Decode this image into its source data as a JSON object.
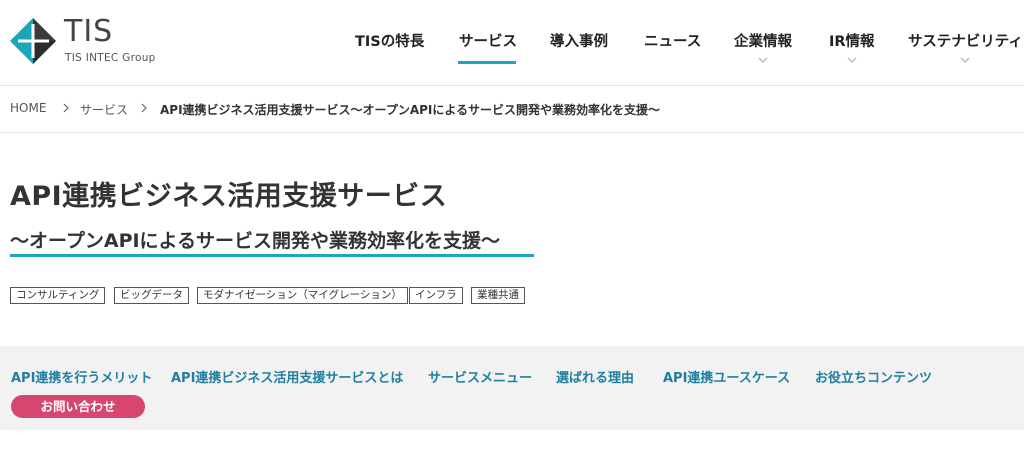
{
  "brand": {
    "name": "TIS",
    "tagline": "TIS INTEC Group",
    "colors": {
      "teal": "#1ba6b9",
      "dark": "#3a3a3a",
      "accent_pink": "#d6466e",
      "link_blue": "#1e7fa0"
    }
  },
  "global_nav": {
    "items": [
      {
        "label": "TISの特長",
        "has_dropdown": false,
        "active": false
      },
      {
        "label": "サービス",
        "has_dropdown": false,
        "active": true
      },
      {
        "label": "導入事例",
        "has_dropdown": false,
        "active": false
      },
      {
        "label": "ニュース",
        "has_dropdown": false,
        "active": false
      },
      {
        "label": "企業情報",
        "has_dropdown": true,
        "active": false
      },
      {
        "label": "IR情報",
        "has_dropdown": true,
        "active": false
      },
      {
        "label": "サステナビリティ",
        "has_dropdown": true,
        "active": false
      }
    ]
  },
  "breadcrumb": {
    "items": [
      {
        "label": "HOME"
      },
      {
        "label": "サービス"
      },
      {
        "label": "API連携ビジネス活用支援サービス～オープンAPIによるサービス開発や業務効率化を支援～"
      }
    ]
  },
  "page": {
    "title": "API連携ビジネス活用支援サービス",
    "subtitle": "～オープンAPIによるサービス開発や業務効率化を支援～"
  },
  "tags": [
    "コンサルティング",
    "ビッグデータ",
    "モダナイゼーション（マイグレーション）",
    "インフラ",
    "業種共通"
  ],
  "sub_nav": {
    "links": [
      "API連携を行うメリット",
      "API連携ビジネス活用支援サービスとは",
      "サービスメニュー",
      "選ばれる理由",
      "API連携ユースケース",
      "お役立ちコンテンツ"
    ],
    "contact_label": "お問い合わせ"
  }
}
